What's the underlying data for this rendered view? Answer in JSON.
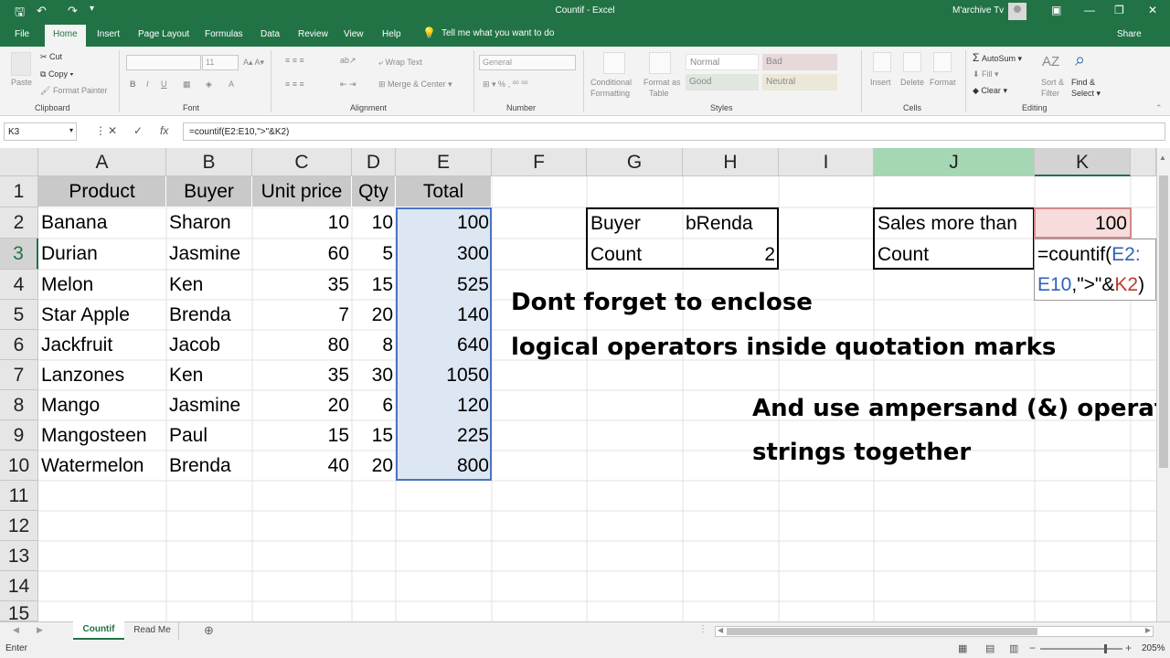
{
  "window": {
    "title": "Countif - Excel",
    "user": "M'archive Tv"
  },
  "tabs": [
    "File",
    "Home",
    "Insert",
    "Page Layout",
    "Formulas",
    "Data",
    "Review",
    "View",
    "Help"
  ],
  "tellme": "Tell me what you want to do",
  "share": "Share",
  "ribbon": {
    "clipboard": {
      "paste": "Paste",
      "cut": "Cut",
      "copy": "Copy",
      "format_painter": "Format Painter",
      "label": "Clipboard"
    },
    "font": {
      "size": "11",
      "label": "Font"
    },
    "alignment": {
      "wrap": "Wrap Text",
      "merge": "Merge & Center",
      "label": "Alignment"
    },
    "number": {
      "format": "General",
      "label": "Number"
    },
    "styles": {
      "conditional": "Conditional",
      "formatting": "Formatting",
      "format_as": "Format as",
      "table": "Table",
      "normal": "Normal",
      "bad": "Bad",
      "good": "Good",
      "neutral": "Neutral",
      "label": "Styles"
    },
    "cells": {
      "insert": "Insert",
      "delete": "Delete",
      "format": "Format",
      "label": "Cells"
    },
    "editing": {
      "autosum": "AutoSum",
      "fill": "Fill",
      "clear": "Clear",
      "sort": "Sort &",
      "filter": "Filter",
      "find": "Find &",
      "select": "Select",
      "label": "Editing"
    }
  },
  "formula_bar": {
    "name_box": "K3",
    "formula": "=countif(E2:E10,\">\"&K2)"
  },
  "columns": [
    "A",
    "B",
    "C",
    "D",
    "E",
    "F",
    "G",
    "H",
    "I",
    "J",
    "K"
  ],
  "rows": [
    "1",
    "2",
    "3",
    "4",
    "5",
    "6",
    "7",
    "8",
    "9",
    "10",
    "11",
    "12",
    "13",
    "14",
    "15"
  ],
  "table": {
    "headers": [
      "Product",
      "Buyer",
      "Unit price",
      "Qty",
      "Total"
    ],
    "rows": [
      [
        "Banana",
        "Sharon",
        "10",
        "10",
        "100"
      ],
      [
        "Durian",
        "Jasmine",
        "60",
        "5",
        "300"
      ],
      [
        "Melon",
        "Ken",
        "35",
        "15",
        "525"
      ],
      [
        "Star Apple",
        "Brenda",
        "7",
        "20",
        "140"
      ],
      [
        "Jackfruit",
        "Jacob",
        "80",
        "8",
        "640"
      ],
      [
        "Lanzones",
        "Ken",
        "35",
        "30",
        "1050"
      ],
      [
        "Mango",
        "Jasmine",
        "20",
        "6",
        "120"
      ],
      [
        "Mangosteen",
        "Paul",
        "15",
        "15",
        "225"
      ],
      [
        "Watermelon",
        "Brenda",
        "40",
        "20",
        "800"
      ]
    ]
  },
  "box1": {
    "buyer_label": "Buyer",
    "buyer_value": "bRenda",
    "count_label": "Count",
    "count_value": "2"
  },
  "box2": {
    "sales_label": "Sales more than",
    "sales_value": "100",
    "count_label": "Count",
    "formula_line1_a": "=countif(",
    "formula_line1_b": "E2:",
    "formula_line2_a": "E10",
    "formula_line2_b": ",\">\"&",
    "formula_line2_c": "K2",
    ")": ")",
    "formula_close": ")"
  },
  "notes": {
    "line1": "Dont forget to enclose",
    "line2": "logical operators inside quotation marks",
    "line3": "And use ampersand (&) operator",
    "line4": "strings together"
  },
  "sheets": {
    "active": "Countif",
    "other": "Read Me"
  },
  "status": {
    "mode": "Enter",
    "zoom": "205%"
  }
}
